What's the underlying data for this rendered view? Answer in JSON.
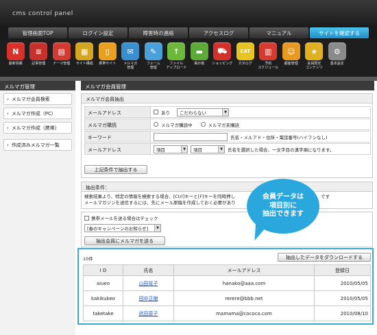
{
  "app": {
    "title": "cms control panel"
  },
  "nav": [
    {
      "label": "管理画面TOP"
    },
    {
      "label": "ログイン設定"
    },
    {
      "label": "障害時の連絡"
    },
    {
      "label": "アクセスログ"
    },
    {
      "label": "マニュアル"
    },
    {
      "label": "サイトを確認する"
    }
  ],
  "icons": [
    {
      "label": "最新情報",
      "icon": "news-icon",
      "color": "#d9302a",
      "glyph": "N"
    },
    {
      "label": "記事管理",
      "icon": "article-icon",
      "color": "#c8302c",
      "glyph": "≡"
    },
    {
      "label": "テーマ管理",
      "icon": "theme-icon",
      "color": "#d23a32",
      "glyph": "▤"
    },
    {
      "label": "サイト構成",
      "icon": "site-icon",
      "color": "#d6a520",
      "glyph": "▦"
    },
    {
      "label": "携帯サイト",
      "icon": "mobile-icon",
      "color": "#e8a01e",
      "glyph": "▯"
    },
    {
      "label": "メルマガ\n管理",
      "icon": "mail-icon",
      "color": "#3a8fd0",
      "glyph": "✉"
    },
    {
      "label": "フォーム\n管理",
      "icon": "form-icon",
      "color": "#4aa0d8",
      "glyph": "✎"
    },
    {
      "label": "ファイル\nアップロード",
      "icon": "upload-icon",
      "color": "#6cb83a",
      "glyph": "↑"
    },
    {
      "label": "掲示板",
      "icon": "board-icon",
      "color": "#5caa38",
      "glyph": "▬"
    },
    {
      "label": "ショッピング",
      "icon": "shopping-icon",
      "color": "#d2322c",
      "glyph": "⛟"
    },
    {
      "label": "カタログ",
      "icon": "catalog-icon",
      "color": "#e8c420",
      "glyph": "CAT"
    },
    {
      "label": "予約\nスケジュール",
      "icon": "calendar-icon",
      "color": "#d83a30",
      "glyph": "▥"
    },
    {
      "label": "顧客管理",
      "icon": "customer-icon",
      "color": "#e89a20",
      "glyph": "☺"
    },
    {
      "label": "会員限定\nコンテンツ",
      "icon": "member-icon",
      "color": "#e0b020",
      "glyph": "★"
    },
    {
      "label": "基本設定",
      "icon": "settings-icon",
      "color": "#8a8a8a",
      "glyph": "⚙"
    }
  ],
  "sidebar": {
    "title": "メルマガ管理",
    "items": [
      {
        "label": "メルマガ会員検索"
      },
      {
        "label": "メルマガ作成（PC）"
      },
      {
        "label": "メルマガ作成（携帯）"
      },
      {
        "label": "作成済みメルマガ一覧"
      }
    ]
  },
  "main": {
    "title": "メルマガ会員管理",
    "search": {
      "title": "メルマガ会員抽出",
      "mail_address_label": "メールアドレス",
      "mail_address_checkbox": "あり",
      "mail_address_select": "こだわらない",
      "subscribe_label": "メルマガ購読",
      "subscribe_option1": "メルマガ購読中",
      "subscribe_option2": "メルマガ未購読",
      "keyword_label": "キーワード",
      "keyword_value": "",
      "keyword_hint": "氏名・メルアド・住所・電話番号(ハイフンなし)",
      "mail_label": "メールアドレス",
      "mail_select1": "項目",
      "mail_select2": "項目",
      "mail_hint": "氏名を選択した場合、一文字目の漢字順になります。",
      "submit_label": "上記条件で抽出する"
    },
    "conditions": {
      "title": "抽出条件：",
      "line1": "検索結果より、特定の情報を検索する場合、[Ctrl]キーと[F]キーを同時押し",
      "line1_tail": "です",
      "line2": "メールマガジンを送信するには、先にメール原稿を作成しておく必要があり"
    },
    "send": {
      "mobile_checkbox": "携帯メールを送る場合はチェック",
      "template_select": "[春のキャンペーンのお知らせ]",
      "send_button": "抽出会員にメルマガを送る"
    }
  },
  "callout": {
    "line1": "会員データは",
    "line2": "項目別に",
    "line3": "抽出できます"
  },
  "results": {
    "count": "10件",
    "download_label": "抽出したデータをダウンロードする",
    "columns": [
      "I D",
      "氏名",
      "メールアドレス",
      "登録日"
    ],
    "rows": [
      {
        "id": "aiueo",
        "name": "山田花子",
        "email": "hanako@aaa.com",
        "date": "2010/05/05"
      },
      {
        "id": "kakikukeo",
        "name": "田中正樹",
        "email": "rerere@bbb.net",
        "date": "2010/05/05"
      },
      {
        "id": "taketake",
        "name": "武田恵子",
        "email": "mamama@cococo.com",
        "date": "2010/08/10"
      }
    ]
  }
}
